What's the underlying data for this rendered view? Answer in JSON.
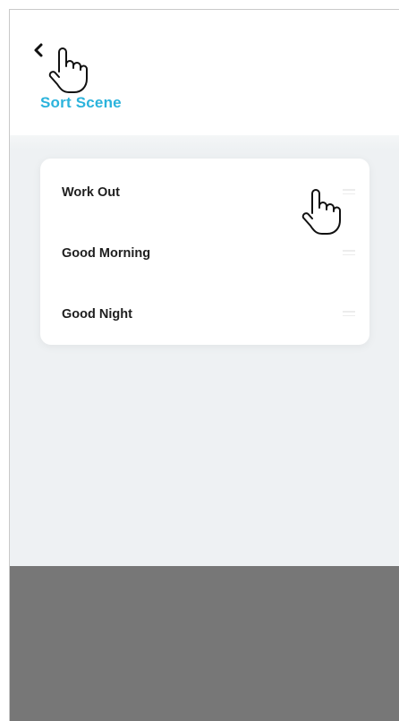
{
  "header": {
    "title": "Sort Scene",
    "back_icon": "chevron-left-icon"
  },
  "scenes": [
    {
      "label": "Work Out"
    },
    {
      "label": "Good Morning"
    },
    {
      "label": "Good Night"
    }
  ],
  "colors": {
    "accent": "#2bb3dc",
    "background": "#eef1f3",
    "bottom_overlay": "#777777"
  }
}
